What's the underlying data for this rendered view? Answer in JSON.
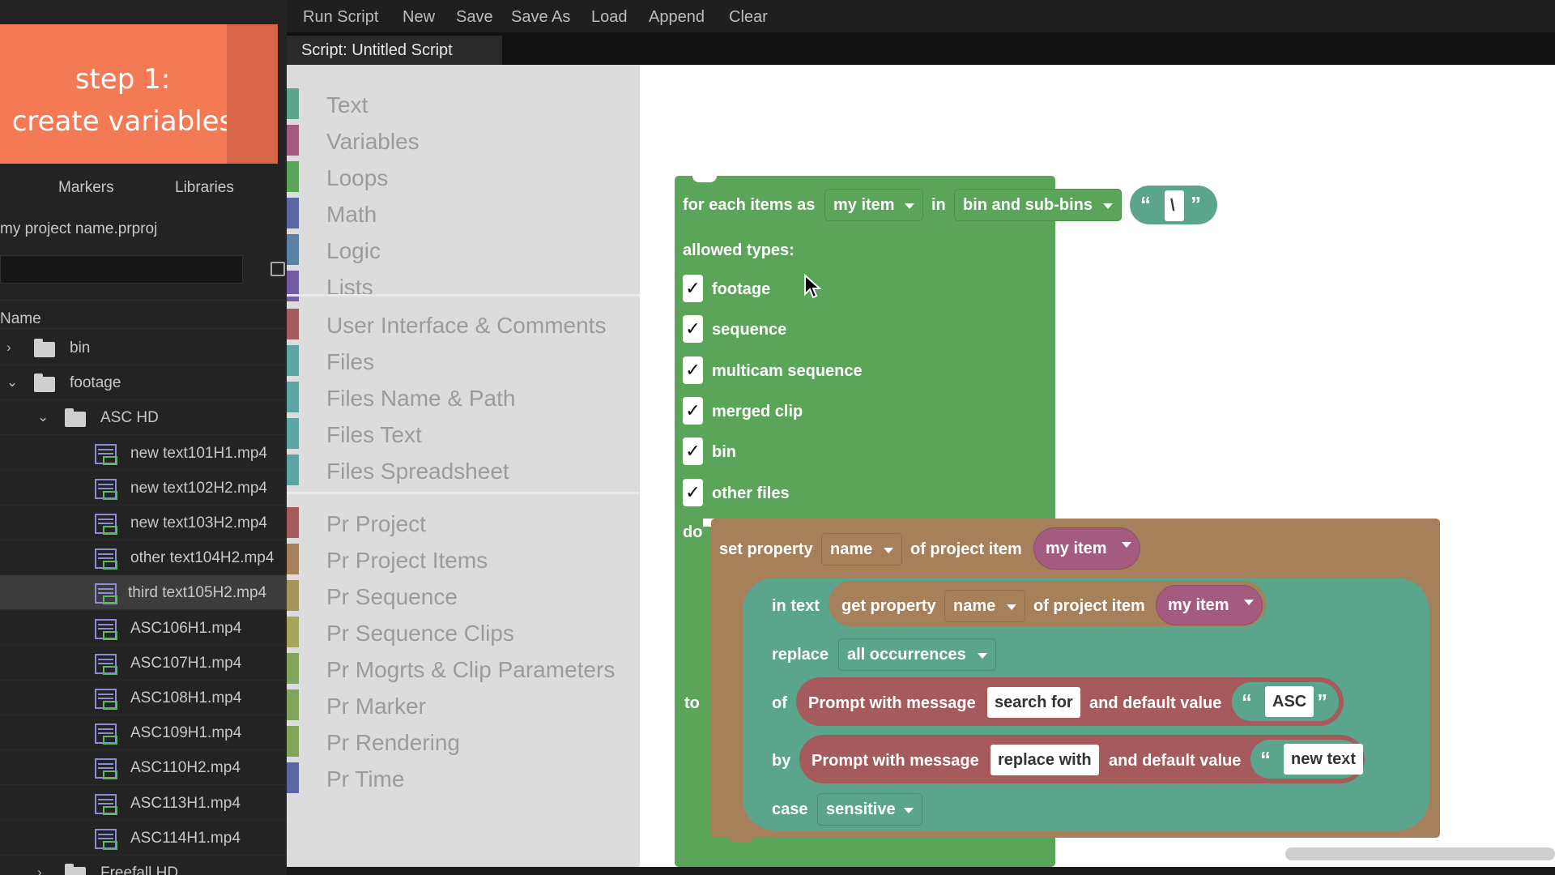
{
  "step_overlay": {
    "line1": "step 1:",
    "line2": "create variables"
  },
  "left_panel": {
    "tabs": [
      "Markers",
      "Libraries"
    ],
    "project_name": "my project name.prproj",
    "column_header": "Name",
    "rows": [
      {
        "label": "bin",
        "type": "folder",
        "expand": "›"
      },
      {
        "label": "footage",
        "type": "folder",
        "expand": "⌄"
      },
      {
        "label": "ASC HD",
        "type": "folder",
        "expand": "⌄"
      },
      {
        "label": "new text101H1.mp4",
        "type": "video"
      },
      {
        "label": "new text102H2.mp4",
        "type": "video"
      },
      {
        "label": "new text103H2.mp4",
        "type": "video"
      },
      {
        "label": "other text104H2.mp4",
        "type": "video"
      },
      {
        "label": "third text105H2.mp4",
        "type": "video",
        "selected": true
      },
      {
        "label": "ASC106H1.mp4",
        "type": "video"
      },
      {
        "label": "ASC107H1.mp4",
        "type": "video"
      },
      {
        "label": "ASC108H1.mp4",
        "type": "video"
      },
      {
        "label": "ASC109H1.mp4",
        "type": "video"
      },
      {
        "label": "ASC110H2.mp4",
        "type": "video"
      },
      {
        "label": "ASC113H1.mp4",
        "type": "video"
      },
      {
        "label": "ASC114H1.mp4",
        "type": "video"
      },
      {
        "label": "Freefall HD",
        "type": "folder",
        "expand": "›"
      }
    ]
  },
  "menu": [
    "Run Script",
    "New",
    "Save",
    "Save As",
    "Load",
    "Append",
    "Clear"
  ],
  "script_title": "Script: Untitled Script",
  "toolbox": {
    "group1": [
      {
        "label": "Text",
        "color": "#5ba58c"
      },
      {
        "label": "Variables",
        "color": "#a55b80"
      },
      {
        "label": "Loops",
        "color": "#5ba55b"
      },
      {
        "label": "Math",
        "color": "#5b67a5"
      },
      {
        "label": "Logic",
        "color": "#5b80a5"
      },
      {
        "label": "Lists",
        "color": "#745ba5"
      }
    ],
    "group2": [
      {
        "label": "User Interface & Comments",
        "color": "#a55b5b"
      },
      {
        "label": "Files",
        "color": "#5ba5a5"
      },
      {
        "label": "Files Name & Path",
        "color": "#5ba5a5"
      },
      {
        "label": "Files Text",
        "color": "#5ba5a5"
      },
      {
        "label": "Files Spreadsheet",
        "color": "#5ba5a5"
      }
    ],
    "group3": [
      {
        "label": "Pr Project",
        "color": "#a55b5b"
      },
      {
        "label": "Pr Project Items",
        "color": "#a5805b"
      },
      {
        "label": "Pr Sequence",
        "color": "#a5955b"
      },
      {
        "label": "Pr Sequence Clips",
        "color": "#a5a55b"
      },
      {
        "label": "Pr Mogrts & Clip Parameters",
        "color": "#80a55b"
      },
      {
        "label": "Pr Marker",
        "color": "#80a55b"
      },
      {
        "label": "Pr Rendering",
        "color": "#80a55b"
      },
      {
        "label": "Pr Time",
        "color": "#5b67a5"
      }
    ]
  },
  "blocks": {
    "foreach": {
      "prefix": "for each items as",
      "var": "my item",
      "in": "in",
      "scope": "bin and sub-bins",
      "quote_open": "“",
      "separator": "\\",
      "quote_close": "”",
      "allowed_label": "allowed types:",
      "types": [
        "footage",
        "sequence",
        "multicam sequence",
        "merged clip",
        "bin",
        "other files"
      ],
      "do": "do",
      "color": "#5ba55b"
    },
    "setprop": {
      "label": "set property",
      "property": "name",
      "of": "of project item",
      "item": "my item",
      "to": "to",
      "color": "#a5805b"
    },
    "replace": {
      "in_text": "in text",
      "get_property": "get property",
      "property": "name",
      "of": "of project item",
      "item": "my item",
      "replace": "replace",
      "mode": "all occurrences",
      "of_label": "of",
      "prompt": "Prompt with message",
      "search_msg": "search for",
      "default_label": "and default value",
      "search_default": "ASC",
      "by": "by",
      "replace_msg": "replace with",
      "replace_default": "new text",
      "case": "case",
      "case_mode": "sensitive",
      "color": "#5ba58c"
    },
    "var_color": "#a55b80",
    "prompt_color": "#a55b5b"
  },
  "checkmark": "✓"
}
